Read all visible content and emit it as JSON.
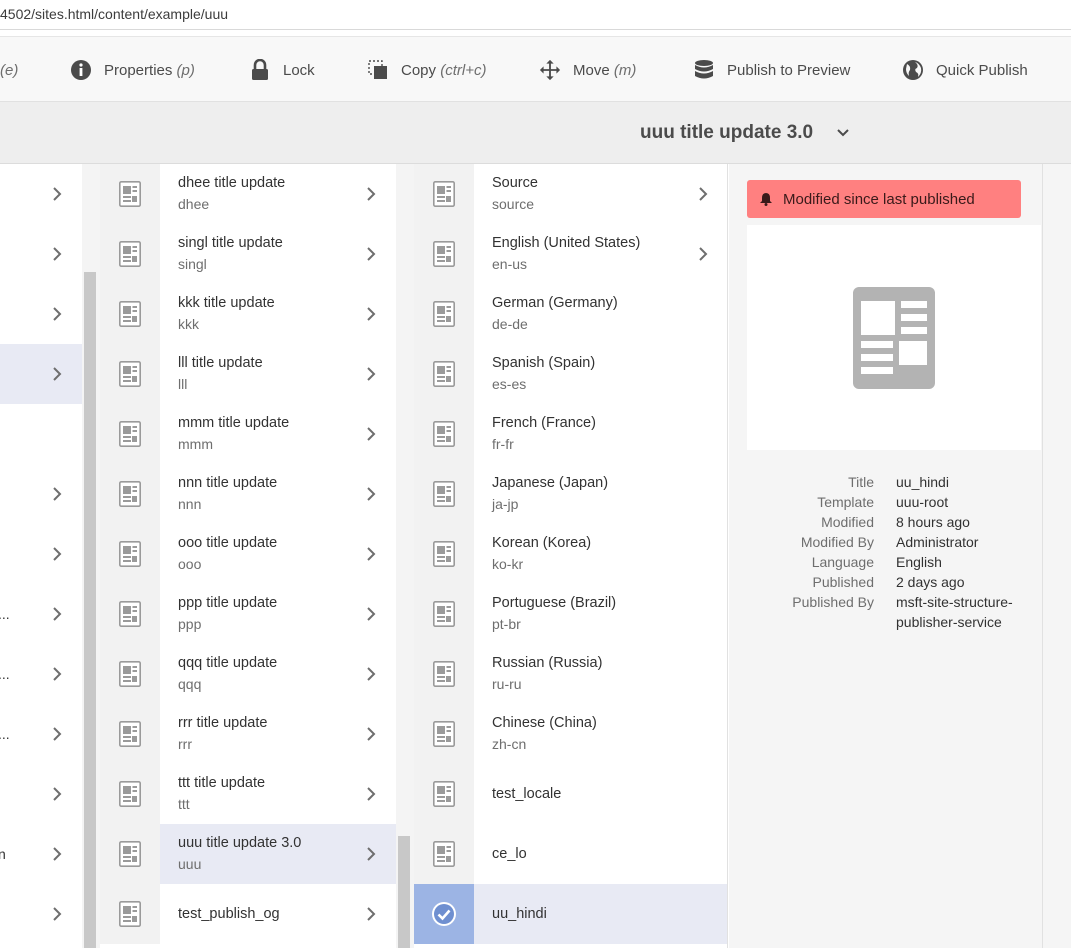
{
  "browser": {
    "url": "4502/sites.html/content/example/uuu"
  },
  "toolbar": {
    "cut_fragment": "(e)",
    "properties": {
      "label": "Properties",
      "shortcut": "(p)"
    },
    "lock": {
      "label": "Lock"
    },
    "copy": {
      "label": "Copy",
      "shortcut": "(ctrl+c)"
    },
    "move": {
      "label": "Move",
      "shortcut": "(m)"
    },
    "publish_preview": {
      "label": "Publish to Preview"
    },
    "quick_publish": {
      "label": "Quick Publish"
    }
  },
  "header": {
    "title": "uuu title update 3.0"
  },
  "column0": {
    "fragments": [
      "...",
      "...",
      "...",
      "n"
    ]
  },
  "column1": {
    "items": [
      {
        "title": "dhee title update",
        "name": "dhee"
      },
      {
        "title": "singl title update",
        "name": "singl"
      },
      {
        "title": "kkk title update",
        "name": "kkk"
      },
      {
        "title": "lll title update",
        "name": "lll"
      },
      {
        "title": "mmm title update",
        "name": "mmm"
      },
      {
        "title": "nnn title update",
        "name": "nnn"
      },
      {
        "title": "ooo title update",
        "name": "ooo"
      },
      {
        "title": "ppp title update",
        "name": "ppp"
      },
      {
        "title": "qqq title update",
        "name": "qqq"
      },
      {
        "title": "rrr title update",
        "name": "rrr"
      },
      {
        "title": "ttt title update",
        "name": "ttt"
      },
      {
        "title": "uuu title update 3.0",
        "name": "uuu"
      },
      {
        "title": "test_publish_og",
        "name": ""
      }
    ]
  },
  "column2": {
    "items": [
      {
        "title": "Source",
        "name": "source"
      },
      {
        "title": "English (United States)",
        "name": "en-us"
      },
      {
        "title": "German (Germany)",
        "name": "de-de"
      },
      {
        "title": "Spanish (Spain)",
        "name": "es-es"
      },
      {
        "title": "French (France)",
        "name": "fr-fr"
      },
      {
        "title": "Japanese (Japan)",
        "name": "ja-jp"
      },
      {
        "title": "Korean (Korea)",
        "name": "ko-kr"
      },
      {
        "title": "Portuguese (Brazil)",
        "name": "pt-br"
      },
      {
        "title": "Russian (Russia)",
        "name": "ru-ru"
      },
      {
        "title": "Chinese (China)",
        "name": "zh-cn"
      },
      {
        "title": "test_locale",
        "name": ""
      },
      {
        "title": "ce_lo",
        "name": ""
      },
      {
        "title": "uu_hindi",
        "name": ""
      }
    ]
  },
  "details": {
    "alert": "Modified since last published",
    "meta": [
      {
        "key": "Title",
        "value": "uu_hindi"
      },
      {
        "key": "Template",
        "value": "uuu-root"
      },
      {
        "key": "Modified",
        "value": "8 hours ago"
      },
      {
        "key": "Modified By",
        "value": "Administrator"
      },
      {
        "key": "Language",
        "value": "English"
      },
      {
        "key": "Published",
        "value": "2 days ago"
      },
      {
        "key": "Published By",
        "value": "msft-site-structure-"
      },
      {
        "key": "",
        "value": "publisher-service"
      }
    ]
  },
  "colors": {
    "alert_bg": "#ff8080",
    "selected_row": "#e8eaf4",
    "checked_thumb": "#9cb4e4"
  },
  "icons": [
    "info-icon",
    "lock-icon",
    "copy-icon",
    "move-icon",
    "database-icon",
    "globe-icon",
    "chevron-down-icon",
    "chevron-right-icon",
    "page-icon",
    "check-icon",
    "bell-icon"
  ]
}
